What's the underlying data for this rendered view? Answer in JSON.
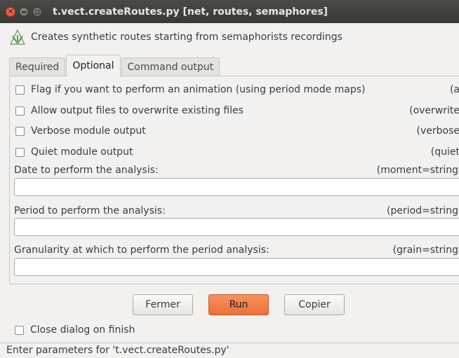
{
  "window": {
    "title": "t.vect.createRoutes.py [net, routes, semaphores]",
    "close_glyph": "×"
  },
  "header": {
    "description": "Creates synthetic routes starting from semaphorists recordings",
    "icon": "grass-logo-icon"
  },
  "tabs": [
    {
      "label": "Required",
      "active": false
    },
    {
      "label": "Optional",
      "active": true
    },
    {
      "label": "Command output",
      "active": false
    }
  ],
  "options": [
    {
      "label": "Flag if you want to perform an animation (using period mode maps)",
      "flag": "(a",
      "checked": false
    },
    {
      "label": "Allow output files to overwrite existing files",
      "flag": "(overwrite",
      "checked": false
    },
    {
      "label": "Verbose module output",
      "flag": "(verbose",
      "checked": false
    },
    {
      "label": "Quiet module output",
      "flag": "(quiet",
      "checked": false
    }
  ],
  "fields": [
    {
      "label": "Date to perform the analysis:",
      "flag": "(moment=string",
      "value": ""
    },
    {
      "label": "Period to perform the analysis:",
      "flag": "(period=string",
      "value": ""
    },
    {
      "label": "Granularity at which to perform the period analysis:",
      "flag": "(grain=string",
      "value": ""
    }
  ],
  "buttons": {
    "close": "Fermer",
    "run": "Run",
    "copy": "Copier"
  },
  "close_on_finish": {
    "label": "Close dialog on finish",
    "checked": false
  },
  "status": "Enter parameters for 't.vect.createRoutes.py'",
  "colors": {
    "run_button": "#ee6f38",
    "titlebar": "#3c3b37"
  }
}
